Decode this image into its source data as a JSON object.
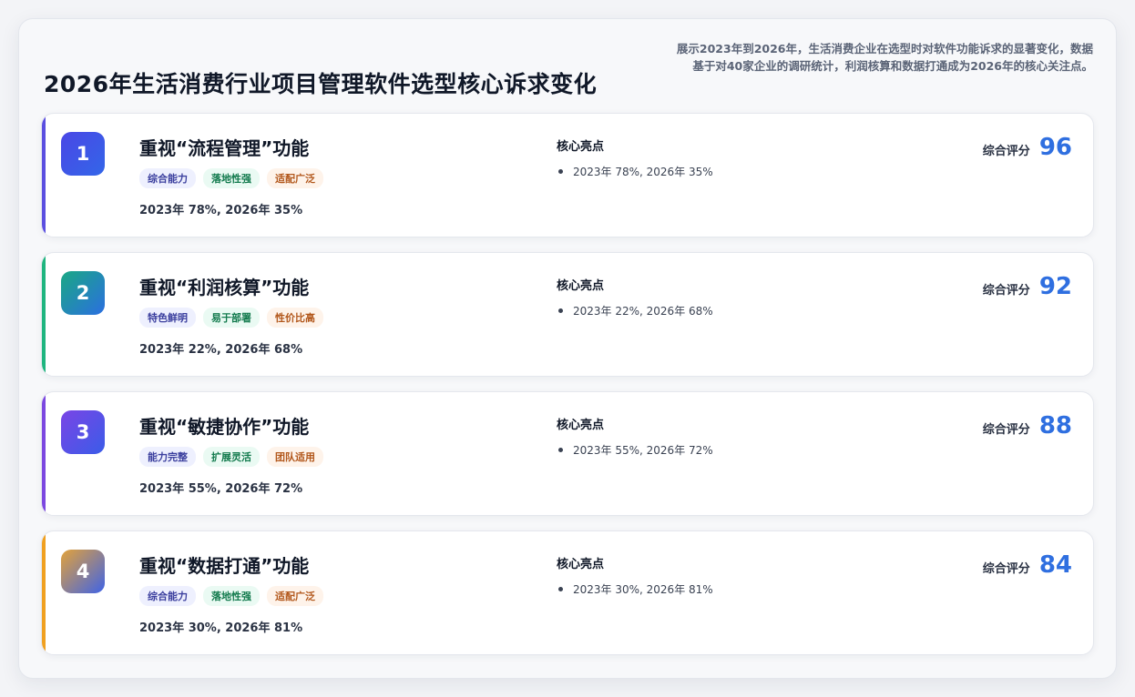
{
  "header": {
    "title": "2026年生活消费行业项目管理软件选型核心诉求变化",
    "description": "展示2023年到2026年，生活消费企业在选型时对软件功能诉求的显著变化，数据基于对40家企业的调研统计，利润核算和数据打通成为2026年的核心关注点。"
  },
  "labels": {
    "highlights_title": "核心亮点",
    "score_label": "综合评分"
  },
  "colors": {
    "score": "#2f6fe0"
  },
  "cards": [
    {
      "rank": "1",
      "title": "重视“流程管理”功能",
      "tags": [
        "综合能力",
        "落地性强",
        "适配广泛"
      ],
      "stat": "2023年 78%, 2026年 35%",
      "highlight": "2023年 78%, 2026年 35%",
      "score": "96",
      "accent": "#5b4fe0",
      "badge_gradient": [
        "#4a47e6",
        "#3366e8"
      ]
    },
    {
      "rank": "2",
      "title": "重视“利润核算”功能",
      "tags": [
        "特色鲜明",
        "易于部署",
        "性价比高"
      ],
      "stat": "2023年 22%, 2026年 68%",
      "highlight": "2023年 22%, 2026年 68%",
      "score": "92",
      "accent": "#1fb57f",
      "badge_gradient": [
        "#1aa884",
        "#2b6fe0"
      ]
    },
    {
      "rank": "3",
      "title": "重视“敏捷协作”功能",
      "tags": [
        "能力完整",
        "扩展灵活",
        "团队适用"
      ],
      "stat": "2023年 55%, 2026年 72%",
      "highlight": "2023年 55%, 2026年 72%",
      "score": "88",
      "accent": "#7c48e0",
      "badge_gradient": [
        "#7a45e6",
        "#3a5ce8"
      ]
    },
    {
      "rank": "4",
      "title": "重视“数据打通”功能",
      "tags": [
        "综合能力",
        "落地性强",
        "适配广泛"
      ],
      "stat": "2023年 30%, 2026年 81%",
      "highlight": "2023年 30%, 2026年 81%",
      "score": "84",
      "accent": "#f0a020",
      "badge_gradient": [
        "#e3a23a",
        "#3f63e6"
      ]
    }
  ]
}
